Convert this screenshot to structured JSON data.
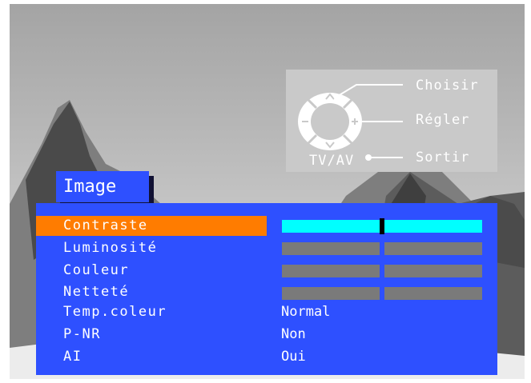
{
  "help": {
    "choisir": "Choisir",
    "regler": "Régler",
    "sortir": "Sortir",
    "tvav": "TV/AV"
  },
  "menu": {
    "title": "Image",
    "items": [
      {
        "label": "Contraste",
        "type": "bar",
        "level": 0.5,
        "active": true
      },
      {
        "label": "Luminosité",
        "type": "bar",
        "level": 0.5,
        "active": false
      },
      {
        "label": "Couleur",
        "type": "bar",
        "level": 0.5,
        "active": false
      },
      {
        "label": "Netteté",
        "type": "bar",
        "level": 0.5,
        "active": false
      },
      {
        "label": "Temp.coleur",
        "type": "value",
        "value": "Normal"
      },
      {
        "label": "P-NR",
        "type": "value",
        "value": "Non"
      },
      {
        "label": "AI",
        "type": "value",
        "value": "Oui"
      }
    ]
  },
  "colors": {
    "menu_bg": "#2e50ff",
    "selected_row": "#ff7c00",
    "active_bar": "#00ffff",
    "inactive_bar": "#7a7a7a"
  }
}
